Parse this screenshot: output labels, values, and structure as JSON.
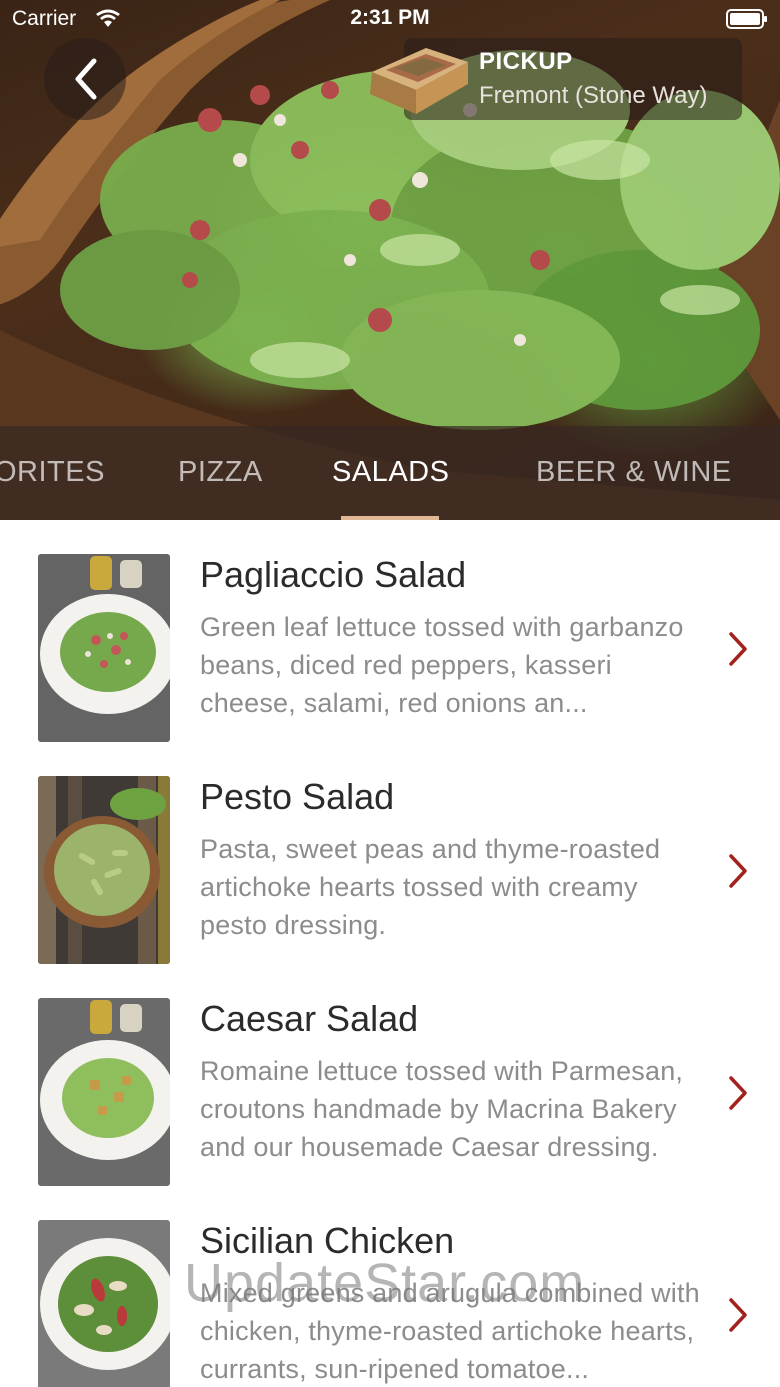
{
  "status_bar": {
    "carrier": "Carrier",
    "time": "2:31 PM"
  },
  "header": {
    "pickup_title": "PICKUP",
    "pickup_location": "Fremont (Stone Way)",
    "back_icon": "chevron-left-icon",
    "pizza_box_icon": "pizza-box-icon"
  },
  "tabs": [
    {
      "label": "FAVORITES",
      "visible_text": "ORITES",
      "active": false
    },
    {
      "label": "PIZZA",
      "active": false
    },
    {
      "label": "SALADS",
      "active": true
    },
    {
      "label": "BEER & WINE",
      "active": false
    }
  ],
  "menu_items": [
    {
      "title": "Pagliaccio Salad",
      "description": "Green leaf lettuce tossed with garbanzo beans, diced red peppers, kasseri cheese, salami, red onions an..."
    },
    {
      "title": "Pesto Salad",
      "description": "Pasta, sweet peas and thyme-roasted artichoke hearts tossed with creamy pesto dressing."
    },
    {
      "title": "Caesar Salad",
      "description": "Romaine lettuce tossed with Parmesan, croutons handmade by Macrina Bakery and our housemade Caesar dressing."
    },
    {
      "title": "Sicilian Chicken",
      "description": "Mixed greens and arugula combined with chicken, thyme-roasted artichoke hearts, currants, sun-ripened tomatoe..."
    }
  ],
  "watermark": "UpdateStar.com",
  "colors": {
    "accent": "#a3221d",
    "tab_underline": "#e1b893",
    "title_text": "#2b2b2b",
    "desc_text": "#8c8c8c"
  }
}
